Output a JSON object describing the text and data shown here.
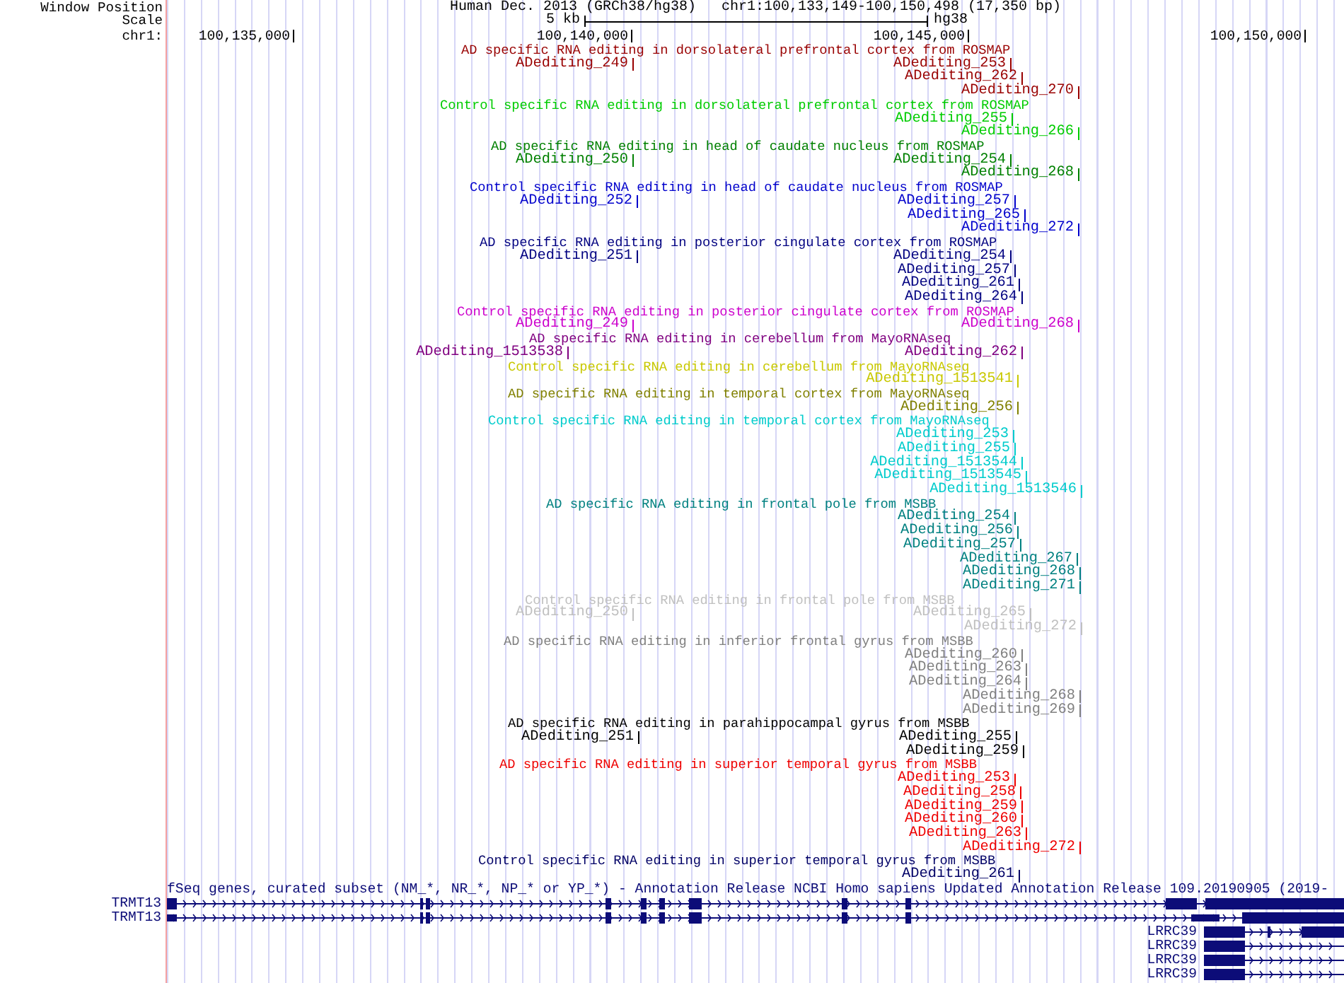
{
  "header": {
    "labels": [
      "Window Position",
      "Scale",
      "chr1:"
    ],
    "assembly": "Human Dec. 2013 (GRCh38/hg38)",
    "position": "chr1:100,133,149-100,150,498 (17,350 bp)",
    "scale_label": "5 kb",
    "scale_assembly": "hg38",
    "ruler_ticks": [
      "100,135,000",
      "100,140,000",
      "100,145,000",
      "100,150,000"
    ]
  },
  "tracks": [
    {
      "title": "AD specific RNA editing in dorsolateral prefrontal cortex from ROSMAP",
      "color": "#990000",
      "features": [
        "ADediting_249",
        "ADediting_253",
        "ADediting_262",
        "ADediting_270"
      ]
    },
    {
      "title": "Control specific RNA editing in dorsolateral prefrontal cortex from ROSMAP",
      "color": "#00cc00",
      "features": [
        "ADediting_255",
        "ADediting_266"
      ]
    },
    {
      "title": "AD specific RNA editing in head of caudate nucleus from ROSMAP",
      "color": "#008000",
      "features": [
        "ADediting_250",
        "ADediting_254",
        "ADediting_268"
      ]
    },
    {
      "title": "Control specific RNA editing in head of caudate nucleus from ROSMAP",
      "color": "#0000cc",
      "features": [
        "ADediting_252",
        "ADediting_257",
        "ADediting_265",
        "ADediting_272"
      ]
    },
    {
      "title": "AD specific RNA editing in posterior cingulate cortex from ROSMAP",
      "color": "#000080",
      "features": [
        "ADediting_251",
        "ADediting_254",
        "ADediting_257",
        "ADediting_261",
        "ADediting_264"
      ]
    },
    {
      "title": "Control specific RNA editing in posterior cingulate cortex from ROSMAP",
      "color": "#cc00cc",
      "features": [
        "ADediting_249",
        "ADediting_268"
      ]
    },
    {
      "title": "AD specific RNA editing in cerebellum from MayoRNAseq",
      "color": "#800080",
      "features": [
        "ADediting_1513538",
        "ADediting_262"
      ]
    },
    {
      "title": "Control specific RNA editing in cerebellum from MayoRNAseq",
      "color": "#c8c800",
      "features": [
        "ADediting_1513541"
      ]
    },
    {
      "title": "AD specific RNA editing in temporal cortex from MayoRNAseq",
      "color": "#808000",
      "features": [
        "ADediting_256"
      ]
    },
    {
      "title": "Control specific RNA editing in temporal cortex from MayoRNAseq",
      "color": "#00cccc",
      "features": [
        "ADediting_253",
        "ADediting_255",
        "ADediting_1513544",
        "ADediting_1513545",
        "ADediting_1513546"
      ]
    },
    {
      "title": "AD specific RNA editing in frontal pole from MSBB",
      "color": "#008080",
      "features": [
        "ADediting_254",
        "ADediting_256",
        "ADediting_257",
        "ADediting_267",
        "ADediting_268",
        "ADediting_271"
      ]
    },
    {
      "title": "Control specific RNA editing in frontal pole from MSBB",
      "color": "#c0c0c0",
      "features": [
        "ADediting_250",
        "ADediting_265",
        "ADediting_272"
      ]
    },
    {
      "title": "AD specific RNA editing in inferior frontal gyrus from MSBB",
      "color": "#808080",
      "features": [
        "ADediting_260",
        "ADediting_263",
        "ADediting_264",
        "ADediting_268",
        "ADediting_269"
      ]
    },
    {
      "title": "AD specific RNA editing in parahippocampal gyrus from MSBB",
      "color": "#000000",
      "features": [
        "ADediting_251",
        "ADediting_255",
        "ADediting_259"
      ]
    },
    {
      "title": "AD specific RNA editing in superior temporal gyrus from MSBB",
      "color": "#ee0000",
      "features": [
        "ADediting_253",
        "ADediting_258",
        "ADediting_259",
        "ADediting_260",
        "ADediting_263",
        "ADediting_272"
      ]
    },
    {
      "title": "Control specific RNA editing in superior temporal gyrus from MSBB",
      "color": "#000066",
      "features": [
        "ADediting_261"
      ]
    }
  ],
  "gene_track": {
    "title": "fSeq genes, curated subset (NM_*, NR_*, NP_* or YP_*) - Annotation Release NCBI Homo sapiens Updated Annotation Release 109.20190905 (2019-",
    "genes": [
      {
        "name": "TRMT13"
      },
      {
        "name": "TRMT13"
      },
      {
        "name": "LRRC39"
      },
      {
        "name": "LRRC39"
      },
      {
        "name": "LRRC39"
      },
      {
        "name": "LRRC39"
      }
    ]
  }
}
